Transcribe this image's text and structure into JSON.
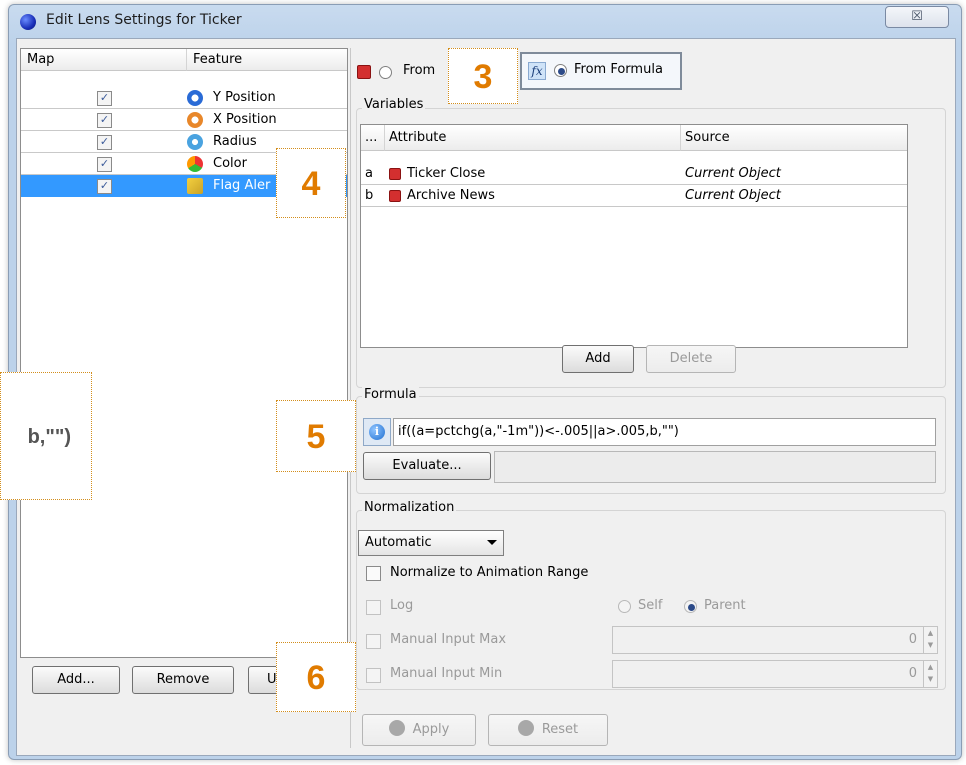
{
  "window": {
    "title": "Edit Lens Settings for Ticker",
    "close_icon": "close-x",
    "close_glyph": "☒"
  },
  "left_panel": {
    "columns": [
      "Map",
      "Feature"
    ],
    "rows": [
      {
        "feature": "Y Position",
        "checked": true,
        "icon": "y-position-icon",
        "selected": false
      },
      {
        "feature": "X Position",
        "checked": true,
        "icon": "x-position-icon",
        "selected": false
      },
      {
        "feature": "Radius",
        "checked": true,
        "icon": "radius-icon",
        "selected": false
      },
      {
        "feature": "Color",
        "checked": true,
        "icon": "color-icon",
        "selected": false
      },
      {
        "feature": "Flag Aler",
        "checked": true,
        "icon": "flag-alert-icon",
        "selected": true
      }
    ],
    "buttons": {
      "add": "Add...",
      "remove": "Remove",
      "third": "U"
    }
  },
  "source_options": {
    "from_first": "From",
    "from_formula": "From Formula",
    "fx": "fx"
  },
  "variables": {
    "label": "Variables",
    "columns": [
      "...",
      "Attribute",
      "Source"
    ],
    "rows": [
      {
        "var": "a",
        "attribute": "Ticker Close",
        "source": "Current Object"
      },
      {
        "var": "b",
        "attribute": "Archive News",
        "source": "Current Object"
      }
    ],
    "add_button": "Add",
    "delete_button": "Delete"
  },
  "formula": {
    "label": "Formula",
    "value": "if((a=pctchg(a,\"-1m\"))<-.005||a>.005,b,\"\")",
    "evaluate_button": "Evaluate...",
    "info_icon": "info-icon"
  },
  "normalization": {
    "label": "Normalization",
    "dropdown": "Automatic",
    "normalize_anim": "Normalize to Animation Range",
    "log": "Log",
    "self": "Self",
    "parent": "Parent",
    "manual_max": "Manual Input Max",
    "manual_min": "Manual Input Min",
    "max_value": "0",
    "min_value": "0"
  },
  "footer": {
    "apply": "Apply",
    "reset": "Reset"
  },
  "callouts": {
    "c3": "3",
    "c4": "4",
    "c5": "5",
    "c6": "6",
    "left_text": "b,\"\")"
  },
  "colors": {
    "accent_orange": "#e07b00",
    "selection_blue": "#3399ff"
  }
}
